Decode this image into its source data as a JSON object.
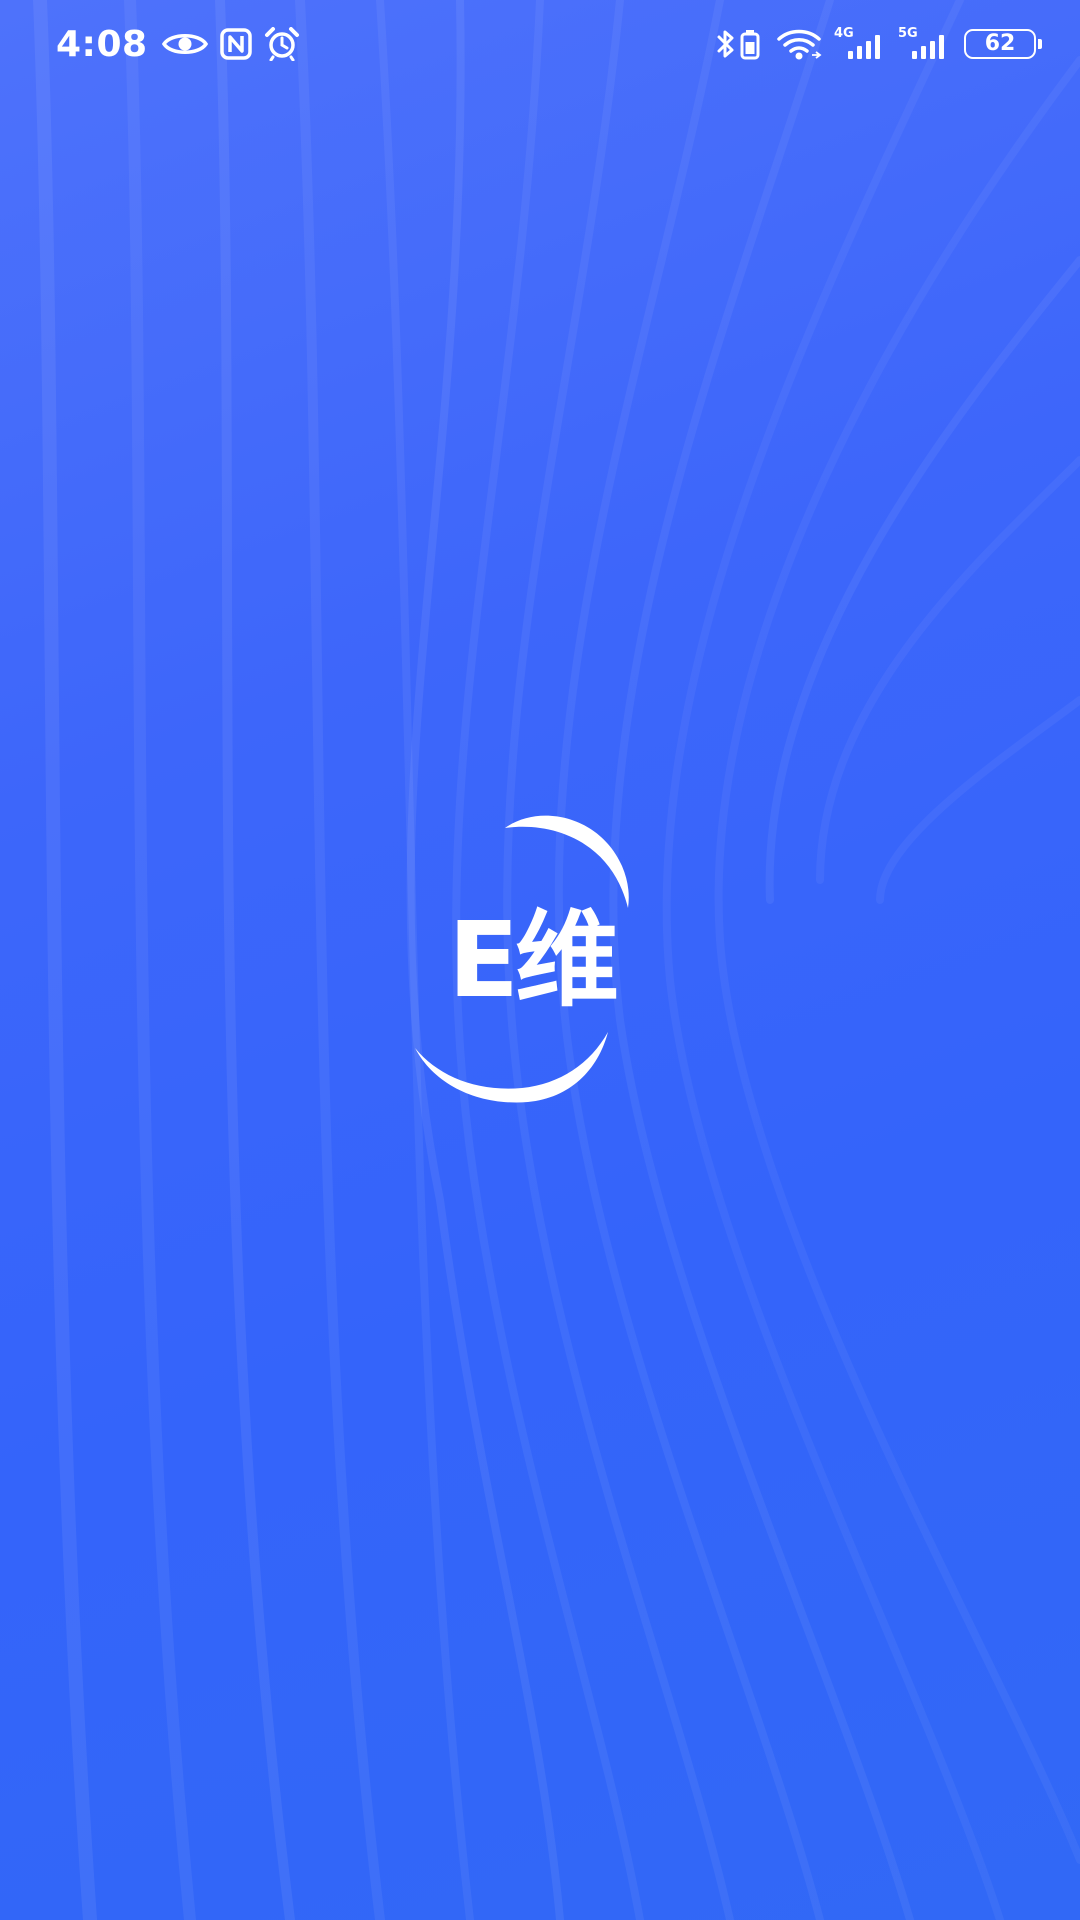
{
  "status_bar": {
    "time": "4:08",
    "left_icons": [
      "eye-icon",
      "nfc-icon",
      "alarm-icon"
    ],
    "right_icons": [
      "bluetooth-icon",
      "battery-saver-icon",
      "wifi-icon",
      "signal-4g-icon",
      "signal-5g-icon"
    ],
    "network_1": "4G",
    "network_2": "5G",
    "battery_level": "62"
  },
  "splash": {
    "logo_text": "E维",
    "background_color": "#3d66fa",
    "logo_color": "#ffffff"
  }
}
